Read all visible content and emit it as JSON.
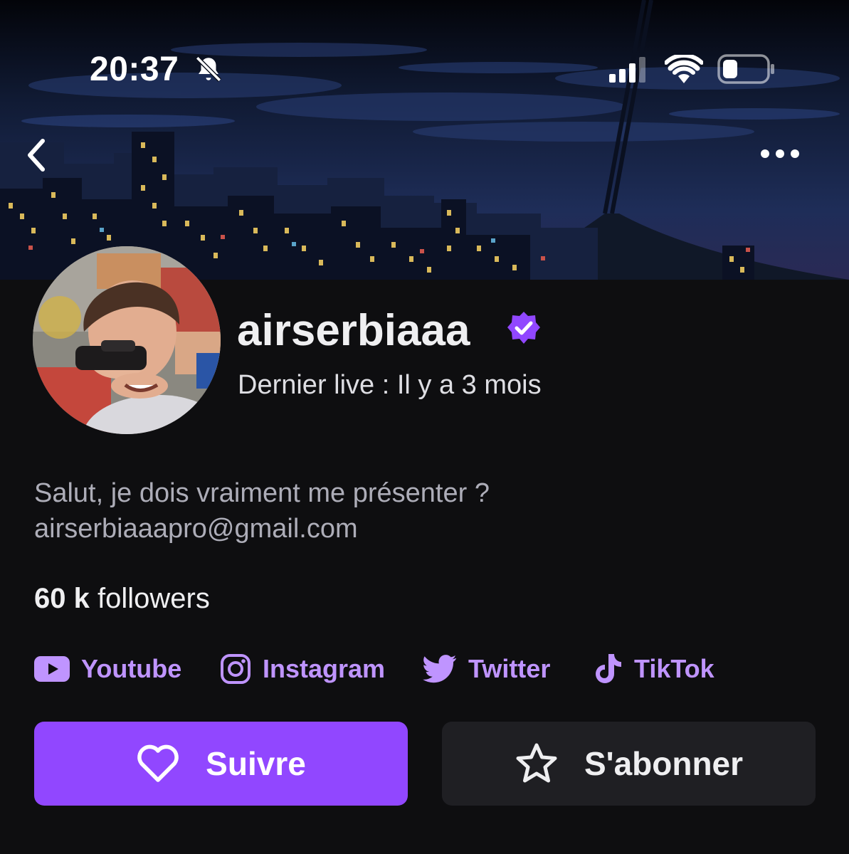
{
  "status_bar": {
    "time": "20:37",
    "icons": [
      "bell-slash-icon",
      "cellular-signal-icon",
      "wifi-icon",
      "battery-icon"
    ]
  },
  "nav": {
    "back_icon": "chevron-left-icon",
    "more_icon": "ellipsis-horizontal-icon"
  },
  "profile": {
    "username": "airserbiaaa",
    "verified": true,
    "last_live": "Dernier live : Il y a 3 mois",
    "bio_lines": [
      "Salut, je dois vraiment me présenter ?",
      "airserbiaaapro@gmail.com"
    ],
    "followers_count": "60 k",
    "followers_label": "followers"
  },
  "social_links": [
    {
      "label": "Youtube",
      "icon": "youtube-icon"
    },
    {
      "label": "Instagram",
      "icon": "instagram-icon"
    },
    {
      "label": "Twitter",
      "icon": "twitter-icon"
    },
    {
      "label": "TikTok",
      "icon": "tiktok-icon"
    }
  ],
  "actions": {
    "follow_label": "Suivre",
    "follow_icon": "heart-outline-icon",
    "subscribe_label": "S'abonner",
    "subscribe_icon": "star-outline-icon"
  },
  "colors": {
    "background": "#0e0e10",
    "accent": "#9147ff",
    "link": "#bf94ff",
    "secondary_button": "#1f1f23",
    "muted_text": "#adadb8"
  }
}
